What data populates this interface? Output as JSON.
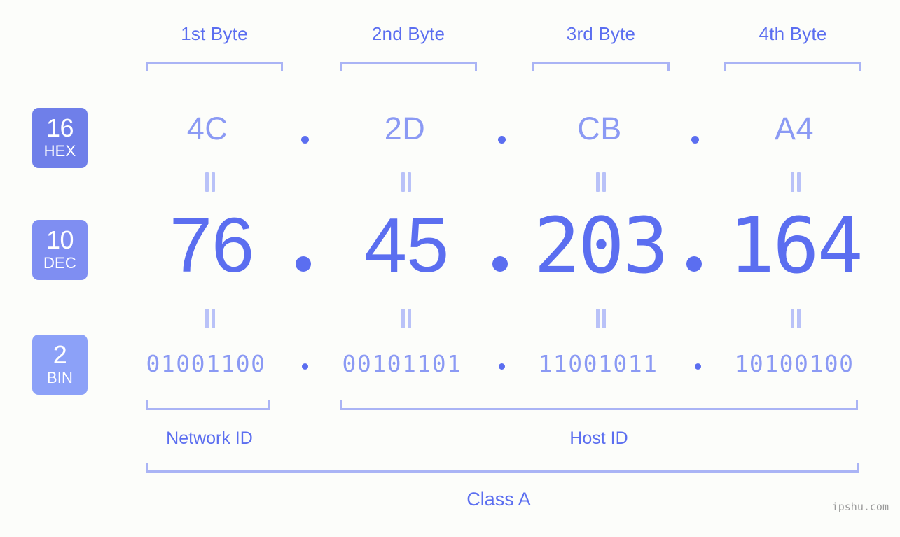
{
  "background_color": "#fcfdfa",
  "accent_color": "#5b6ef0",
  "accent_light_color": "#8b9af4",
  "bracket_color": "#aab4f5",
  "bytes": {
    "headers": [
      {
        "label": "1st Byte"
      },
      {
        "label": "2nd Byte"
      },
      {
        "label": "3rd Byte"
      },
      {
        "label": "4th Byte"
      }
    ]
  },
  "rows": [
    {
      "badge_number": "16",
      "badge_name": "HEX",
      "badge_color": "#6f7fe9",
      "values": [
        "4C",
        "2D",
        "CB",
        "A4"
      ],
      "separator": "."
    },
    {
      "badge_number": "10",
      "badge_name": "DEC",
      "badge_color": "#7f8ef2",
      "values": [
        "76",
        "45",
        "203",
        "164"
      ],
      "separator": "."
    },
    {
      "badge_number": "2",
      "badge_name": "BIN",
      "badge_color": "#8ca1f8",
      "values": [
        "01001100",
        "00101101",
        "11001011",
        "10100100"
      ],
      "separator": "."
    }
  ],
  "equality_mark": "=",
  "segments": {
    "network_id": "Network ID",
    "host_id": "Host ID"
  },
  "class_label": "Class A",
  "watermark": "ipshu.com"
}
